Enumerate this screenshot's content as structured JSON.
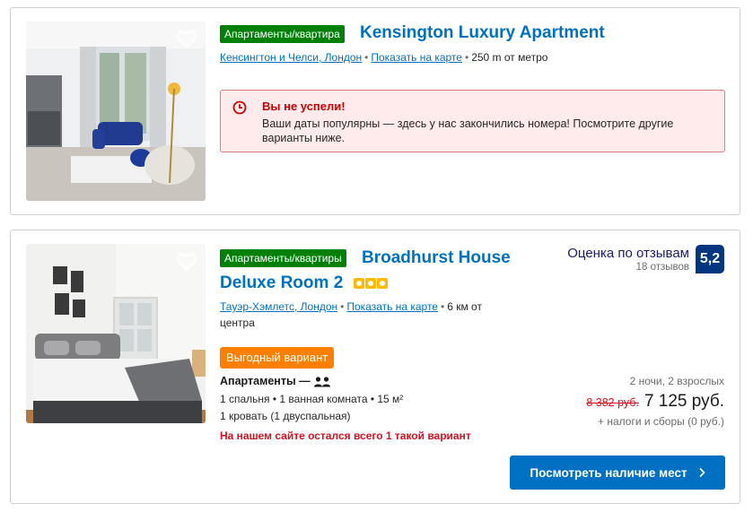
{
  "listings": [
    {
      "type_badge": "Апартаменты/квартира",
      "title": "Kensington Luxury Apartment",
      "district": "Кенсингтон и Челси, Лондон",
      "map_link": "Показать на карте",
      "distance": "250 m от метро",
      "alert": {
        "title": "Вы не успели!",
        "text": "Ваши даты популярны — здесь у нас закончились номера! Посмотрите другие варианты ниже.",
        "icon": "clock-icon"
      },
      "favorite_icon": "heart-icon"
    },
    {
      "type_badge": "Апартаменты/квартиры",
      "title_line1": "Broadhurst House",
      "title_line2": "Deluxe Room 2",
      "stars": 3,
      "district": "Тауэр-Хэмлетс, Лондон",
      "map_link": "Показать на карте",
      "distance_line1": "6 км от",
      "distance_line2": "центра",
      "deal_badge": "Выгодный вариант",
      "unit_type": "Апартаменты",
      "unit_separator": "—",
      "guests_icon": "two-persons-icon",
      "rooms": "1 спальня • 1 ванная комната • 15 м²",
      "beds": "1 кровать (1 двуспальная)",
      "scarcity": "На нашем сайте остался всего 1 такой вариант",
      "review": {
        "label": "Оценка по отзывам",
        "count": "18 отзывов",
        "score": "5,2"
      },
      "price": {
        "meta": "2 ночи, 2 взрослых",
        "old": "8 382 руб.",
        "current": "7 125 руб.",
        "taxes": "+ налоги и сборы (0 руб.)"
      },
      "cta_label": "Посмотреть наличие мест",
      "cta_icon": "chevron-right-icon",
      "favorite_icon": "heart-icon"
    }
  ],
  "colors": {
    "link": "#0071c2",
    "badge_green": "#008009",
    "deal_orange": "#ff8000",
    "alert_red": "#cc0000",
    "score_blue": "#003580",
    "star_yellow": "#febb02"
  }
}
